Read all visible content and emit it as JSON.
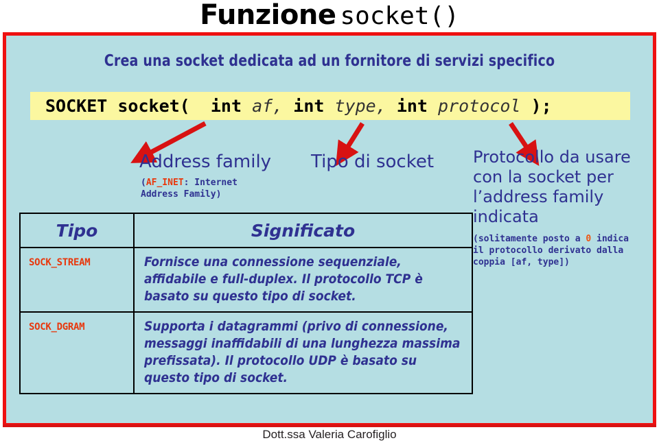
{
  "slide": {
    "title_word": "Funzione",
    "title_code": "socket()",
    "subtitle": "Crea una socket dedicata ad un fornitore di servizi specifico",
    "footer": "Dott.ssa Valeria Carofiglio"
  },
  "prototype": {
    "return_type": "SOCKET",
    "function_name": "socket(",
    "param1_type": "int",
    "param1_name": "af,",
    "param2_type": "int",
    "param2_name": "type,",
    "param3_type": "int",
    "param3_name": "protocol",
    "closing": ");"
  },
  "callouts": {
    "address_family": {
      "title": "Address family",
      "note_open": "(",
      "note_highlight": "AF_INET",
      "note_rest": ": Internet",
      "note_line2": "Address Family)"
    },
    "socket_type": {
      "title": "Tipo di socket"
    },
    "protocol": {
      "title": "Protocollo da usare con la socket per l’address family indicata",
      "note_prefix": "(solitamente posto a ",
      "note_highlight": "0",
      "note_suffix": " indica il protocollo derivato dalla coppia [af, type])"
    }
  },
  "table": {
    "headers": [
      "Tipo",
      "Significato"
    ],
    "rows": [
      {
        "type": "SOCK_STREAM",
        "meaning": "Fornisce una connessione sequenziale, affidabile e full-duplex. Il protocollo TCP è basato su questo tipo di socket."
      },
      {
        "type": "SOCK_DGRAM",
        "meaning": "Supporta i datagrammi (privo di connessione, messaggi inaffidabili di una lunghezza massima prefissata). Il protocollo UDP è basato su questo tipo di socket."
      }
    ]
  },
  "colors": {
    "panel_border": "#ee1111",
    "panel_background": "#b5dee3",
    "code_background": "#fbf7a0",
    "text_blue": "#2f3191",
    "accent_red": "#e8380d",
    "arrow_red": "#d81212"
  }
}
